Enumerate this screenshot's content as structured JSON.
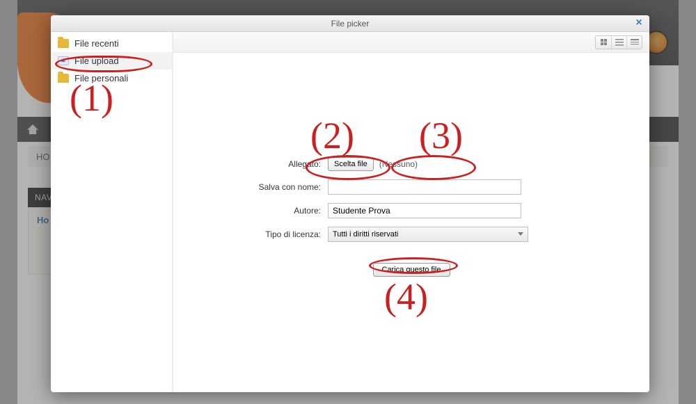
{
  "modal": {
    "title": "File picker",
    "close_label": "×"
  },
  "repos": {
    "recent": {
      "label": "File recenti"
    },
    "upload": {
      "label": "File upload"
    },
    "personal": {
      "label": "File personali"
    }
  },
  "form": {
    "attachment_label": "Allegato:",
    "choose_file_btn": "Scelta file",
    "no_file_text": "(Nessuno)",
    "save_as_label": "Salva con nome:",
    "save_as_value": "",
    "author_label": "Autore:",
    "author_value": "Studente Prova",
    "license_label": "Tipo di licenza:",
    "license_value": "Tutti i diritti riservati",
    "submit_label": "Carica questo file"
  },
  "bg": {
    "breadcrumb": "HO",
    "navblock_title": "NAV",
    "navblock_home": "Ho"
  },
  "annotations": {
    "n1": "(1)",
    "n2": "(2)",
    "n3": "(3)",
    "n4": "(4)"
  }
}
